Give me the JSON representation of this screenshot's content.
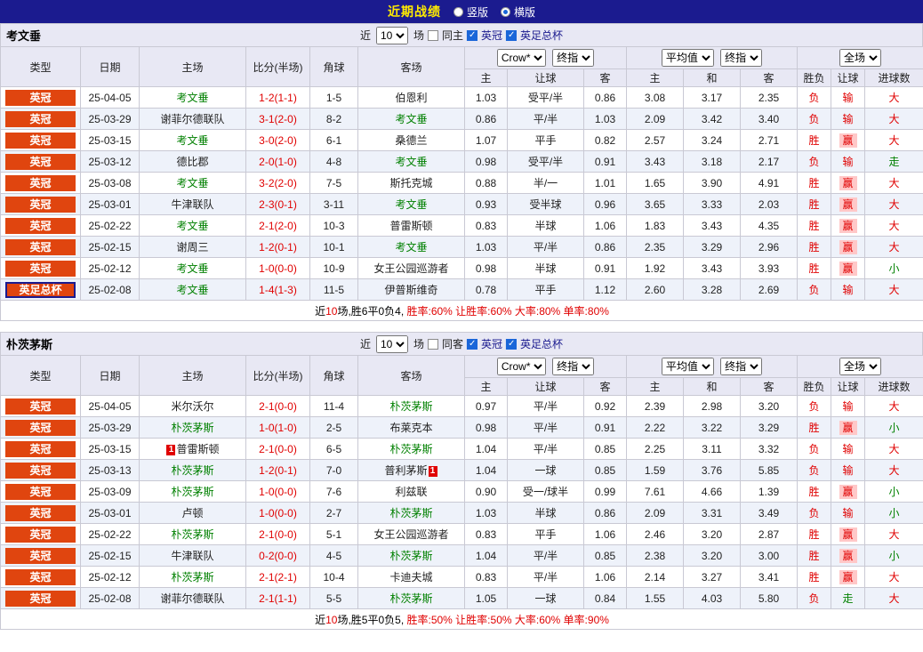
{
  "colors": {
    "topbar_bg": "#1b1b8f",
    "title_text": "#ffeb00",
    "type_badge_bg": "#e0450f",
    "self_team": "#008000",
    "score_text": "#e00000",
    "win_highlight_bg": "#ffc8c8",
    "header_bg": "#e8e8f4",
    "alt_row_bg": "#eef2fa"
  },
  "topbar": {
    "title": "近期战绩",
    "radios": [
      {
        "label": "竖版",
        "selected": false
      },
      {
        "label": "横版",
        "selected": true
      }
    ]
  },
  "table_header": {
    "type": "类型",
    "date": "日期",
    "home": "主场",
    "score": "比分(半场)",
    "corner": "角球",
    "away": "客场",
    "bookmaker": "Crow*",
    "final_index": "终指",
    "average": "平均值",
    "final_index2": "终指",
    "full_match": "全场",
    "asian_home": "主",
    "asian_handicap": "让球",
    "asian_away": "客",
    "euro_home": "主",
    "euro_draw": "和",
    "euro_away": "客",
    "result": "胜负",
    "let_result": "让球",
    "goals": "进球数"
  },
  "sections": [
    {
      "team": "考文垂",
      "filter": {
        "near": "近",
        "count": "10",
        "games": "场",
        "same": "同主",
        "league1": "英冠",
        "league2": "英足总杯"
      },
      "rows": [
        {
          "type": "英冠",
          "cup": false,
          "date": "25-04-05",
          "home": "考文垂",
          "home_self": true,
          "home_card": "",
          "score": "1-2(1-1)",
          "corner": "1-5",
          "away": "伯恩利",
          "away_self": false,
          "away_card": "",
          "asian": [
            "1.03",
            "受平/半",
            "0.86"
          ],
          "euro": [
            "3.08",
            "3.17",
            "2.35"
          ],
          "result": "负",
          "let": "输",
          "let_state": "lose",
          "goal": "大",
          "goal_state": "big"
        },
        {
          "type": "英冠",
          "cup": false,
          "date": "25-03-29",
          "home": "谢菲尔德联队",
          "home_self": false,
          "home_card": "",
          "score": "3-1(2-0)",
          "corner": "8-2",
          "away": "考文垂",
          "away_self": true,
          "away_card": "",
          "asian": [
            "0.86",
            "平/半",
            "1.03"
          ],
          "euro": [
            "2.09",
            "3.42",
            "3.40"
          ],
          "result": "负",
          "let": "输",
          "let_state": "lose",
          "goal": "大",
          "goal_state": "big"
        },
        {
          "type": "英冠",
          "cup": false,
          "date": "25-03-15",
          "home": "考文垂",
          "home_self": true,
          "home_card": "",
          "score": "3-0(2-0)",
          "corner": "6-1",
          "away": "桑德兰",
          "away_self": false,
          "away_card": "",
          "asian": [
            "1.07",
            "平手",
            "0.82"
          ],
          "euro": [
            "2.57",
            "3.24",
            "2.71"
          ],
          "result": "胜",
          "let": "赢",
          "let_state": "win",
          "goal": "大",
          "goal_state": "big"
        },
        {
          "type": "英冠",
          "cup": false,
          "date": "25-03-12",
          "home": "德比郡",
          "home_self": false,
          "home_card": "",
          "score": "2-0(1-0)",
          "corner": "4-8",
          "away": "考文垂",
          "away_self": true,
          "away_card": "",
          "asian": [
            "0.98",
            "受平/半",
            "0.91"
          ],
          "euro": [
            "3.43",
            "3.18",
            "2.17"
          ],
          "result": "负",
          "let": "输",
          "let_state": "lose",
          "goal": "走",
          "goal_state": "push"
        },
        {
          "type": "英冠",
          "cup": false,
          "date": "25-03-08",
          "home": "考文垂",
          "home_self": true,
          "home_card": "",
          "score": "3-2(2-0)",
          "corner": "7-5",
          "away": "斯托克城",
          "away_self": false,
          "away_card": "",
          "asian": [
            "0.88",
            "半/一",
            "1.01"
          ],
          "euro": [
            "1.65",
            "3.90",
            "4.91"
          ],
          "result": "胜",
          "let": "赢",
          "let_state": "win",
          "goal": "大",
          "goal_state": "big"
        },
        {
          "type": "英冠",
          "cup": false,
          "date": "25-03-01",
          "home": "牛津联队",
          "home_self": false,
          "home_card": "",
          "score": "2-3(0-1)",
          "corner": "3-11",
          "away": "考文垂",
          "away_self": true,
          "away_card": "",
          "asian": [
            "0.93",
            "受半球",
            "0.96"
          ],
          "euro": [
            "3.65",
            "3.33",
            "2.03"
          ],
          "result": "胜",
          "let": "赢",
          "let_state": "win",
          "goal": "大",
          "goal_state": "big"
        },
        {
          "type": "英冠",
          "cup": false,
          "date": "25-02-22",
          "home": "考文垂",
          "home_self": true,
          "home_card": "",
          "score": "2-1(2-0)",
          "corner": "10-3",
          "away": "普雷斯顿",
          "away_self": false,
          "away_card": "",
          "asian": [
            "0.83",
            "半球",
            "1.06"
          ],
          "euro": [
            "1.83",
            "3.43",
            "4.35"
          ],
          "result": "胜",
          "let": "赢",
          "let_state": "win",
          "goal": "大",
          "goal_state": "big"
        },
        {
          "type": "英冠",
          "cup": false,
          "date": "25-02-15",
          "home": "谢周三",
          "home_self": false,
          "home_card": "",
          "score": "1-2(0-1)",
          "corner": "10-1",
          "away": "考文垂",
          "away_self": true,
          "away_card": "",
          "asian": [
            "1.03",
            "平/半",
            "0.86"
          ],
          "euro": [
            "2.35",
            "3.29",
            "2.96"
          ],
          "result": "胜",
          "let": "赢",
          "let_state": "win",
          "goal": "大",
          "goal_state": "big"
        },
        {
          "type": "英冠",
          "cup": false,
          "date": "25-02-12",
          "home": "考文垂",
          "home_self": true,
          "home_card": "",
          "score": "1-0(0-0)",
          "corner": "10-9",
          "away": "女王公园巡游者",
          "away_self": false,
          "away_card": "",
          "asian": [
            "0.98",
            "半球",
            "0.91"
          ],
          "euro": [
            "1.92",
            "3.43",
            "3.93"
          ],
          "result": "胜",
          "let": "赢",
          "let_state": "win",
          "goal": "小",
          "goal_state": "small"
        },
        {
          "type": "英足总杯",
          "cup": true,
          "date": "25-02-08",
          "home": "考文垂",
          "home_self": true,
          "home_card": "",
          "score": "1-4(1-3)",
          "corner": "11-5",
          "away": "伊普斯维奇",
          "away_self": false,
          "away_card": "",
          "asian": [
            "0.78",
            "平手",
            "1.12"
          ],
          "euro": [
            "2.60",
            "3.28",
            "2.69"
          ],
          "result": "负",
          "let": "输",
          "let_state": "lose",
          "goal": "大",
          "goal_state": "big"
        }
      ],
      "summary": {
        "prefix": "近",
        "count": "10",
        "middle": "场,胜6平0负4, ",
        "stats": "胜率:60% 让胜率:60% 大率:80% 单率:80%"
      }
    },
    {
      "team": "朴茨茅斯",
      "filter": {
        "near": "近",
        "count": "10",
        "games": "场",
        "same": "同客",
        "league1": "英冠",
        "league2": "英足总杯"
      },
      "rows": [
        {
          "type": "英冠",
          "cup": false,
          "date": "25-04-05",
          "home": "米尔沃尔",
          "home_self": false,
          "home_card": "",
          "score": "2-1(0-0)",
          "corner": "11-4",
          "away": "朴茨茅斯",
          "away_self": true,
          "away_card": "",
          "asian": [
            "0.97",
            "平/半",
            "0.92"
          ],
          "euro": [
            "2.39",
            "2.98",
            "3.20"
          ],
          "result": "负",
          "let": "输",
          "let_state": "lose",
          "goal": "大",
          "goal_state": "big"
        },
        {
          "type": "英冠",
          "cup": false,
          "date": "25-03-29",
          "home": "朴茨茅斯",
          "home_self": true,
          "home_card": "",
          "score": "1-0(1-0)",
          "corner": "2-5",
          "away": "布莱克本",
          "away_self": false,
          "away_card": "",
          "asian": [
            "0.98",
            "平/半",
            "0.91"
          ],
          "euro": [
            "2.22",
            "3.22",
            "3.29"
          ],
          "result": "胜",
          "let": "赢",
          "let_state": "win",
          "goal": "小",
          "goal_state": "small"
        },
        {
          "type": "英冠",
          "cup": false,
          "date": "25-03-15",
          "home": "普雷斯顿",
          "home_self": false,
          "home_card": "1",
          "score": "2-1(0-0)",
          "corner": "6-5",
          "away": "朴茨茅斯",
          "away_self": true,
          "away_card": "",
          "asian": [
            "1.04",
            "平/半",
            "0.85"
          ],
          "euro": [
            "2.25",
            "3.11",
            "3.32"
          ],
          "result": "负",
          "let": "输",
          "let_state": "lose",
          "goal": "大",
          "goal_state": "big"
        },
        {
          "type": "英冠",
          "cup": false,
          "date": "25-03-13",
          "home": "朴茨茅斯",
          "home_self": true,
          "home_card": "",
          "score": "1-2(0-1)",
          "corner": "7-0",
          "away": "普利茅斯",
          "away_self": false,
          "away_card": "1",
          "asian": [
            "1.04",
            "一球",
            "0.85"
          ],
          "euro": [
            "1.59",
            "3.76",
            "5.85"
          ],
          "result": "负",
          "let": "输",
          "let_state": "lose",
          "goal": "大",
          "goal_state": "big"
        },
        {
          "type": "英冠",
          "cup": false,
          "date": "25-03-09",
          "home": "朴茨茅斯",
          "home_self": true,
          "home_card": "",
          "score": "1-0(0-0)",
          "corner": "7-6",
          "away": "利兹联",
          "away_self": false,
          "away_card": "",
          "asian": [
            "0.90",
            "受一/球半",
            "0.99"
          ],
          "euro": [
            "7.61",
            "4.66",
            "1.39"
          ],
          "result": "胜",
          "let": "赢",
          "let_state": "win",
          "goal": "小",
          "goal_state": "small"
        },
        {
          "type": "英冠",
          "cup": false,
          "date": "25-03-01",
          "home": "卢顿",
          "home_self": false,
          "home_card": "",
          "score": "1-0(0-0)",
          "corner": "2-7",
          "away": "朴茨茅斯",
          "away_self": true,
          "away_card": "",
          "asian": [
            "1.03",
            "半球",
            "0.86"
          ],
          "euro": [
            "2.09",
            "3.31",
            "3.49"
          ],
          "result": "负",
          "let": "输",
          "let_state": "lose",
          "goal": "小",
          "goal_state": "small"
        },
        {
          "type": "英冠",
          "cup": false,
          "date": "25-02-22",
          "home": "朴茨茅斯",
          "home_self": true,
          "home_card": "",
          "score": "2-1(0-0)",
          "corner": "5-1",
          "away": "女王公园巡游者",
          "away_self": false,
          "away_card": "",
          "asian": [
            "0.83",
            "平手",
            "1.06"
          ],
          "euro": [
            "2.46",
            "3.20",
            "2.87"
          ],
          "result": "胜",
          "let": "赢",
          "let_state": "win",
          "goal": "大",
          "goal_state": "big"
        },
        {
          "type": "英冠",
          "cup": false,
          "date": "25-02-15",
          "home": "牛津联队",
          "home_self": false,
          "home_card": "",
          "score": "0-2(0-0)",
          "corner": "4-5",
          "away": "朴茨茅斯",
          "away_self": true,
          "away_card": "",
          "asian": [
            "1.04",
            "平/半",
            "0.85"
          ],
          "euro": [
            "2.38",
            "3.20",
            "3.00"
          ],
          "result": "胜",
          "let": "赢",
          "let_state": "win",
          "goal": "小",
          "goal_state": "small"
        },
        {
          "type": "英冠",
          "cup": false,
          "date": "25-02-12",
          "home": "朴茨茅斯",
          "home_self": true,
          "home_card": "",
          "score": "2-1(2-1)",
          "corner": "10-4",
          "away": "卡迪夫城",
          "away_self": false,
          "away_card": "",
          "asian": [
            "0.83",
            "平/半",
            "1.06"
          ],
          "euro": [
            "2.14",
            "3.27",
            "3.41"
          ],
          "result": "胜",
          "let": "赢",
          "let_state": "win",
          "goal": "大",
          "goal_state": "big"
        },
        {
          "type": "英冠",
          "cup": false,
          "date": "25-02-08",
          "home": "谢菲尔德联队",
          "home_self": false,
          "home_card": "",
          "score": "2-1(1-1)",
          "corner": "5-5",
          "away": "朴茨茅斯",
          "away_self": true,
          "away_card": "",
          "asian": [
            "1.05",
            "一球",
            "0.84"
          ],
          "euro": [
            "1.55",
            "4.03",
            "5.80"
          ],
          "result": "负",
          "let": "走",
          "let_state": "push",
          "goal": "大",
          "goal_state": "big"
        }
      ],
      "summary": {
        "prefix": "近",
        "count": "10",
        "middle": "场,胜5平0负5, ",
        "stats": "胜率:50% 让胜率:50% 大率:60% 单率:90%"
      }
    }
  ]
}
